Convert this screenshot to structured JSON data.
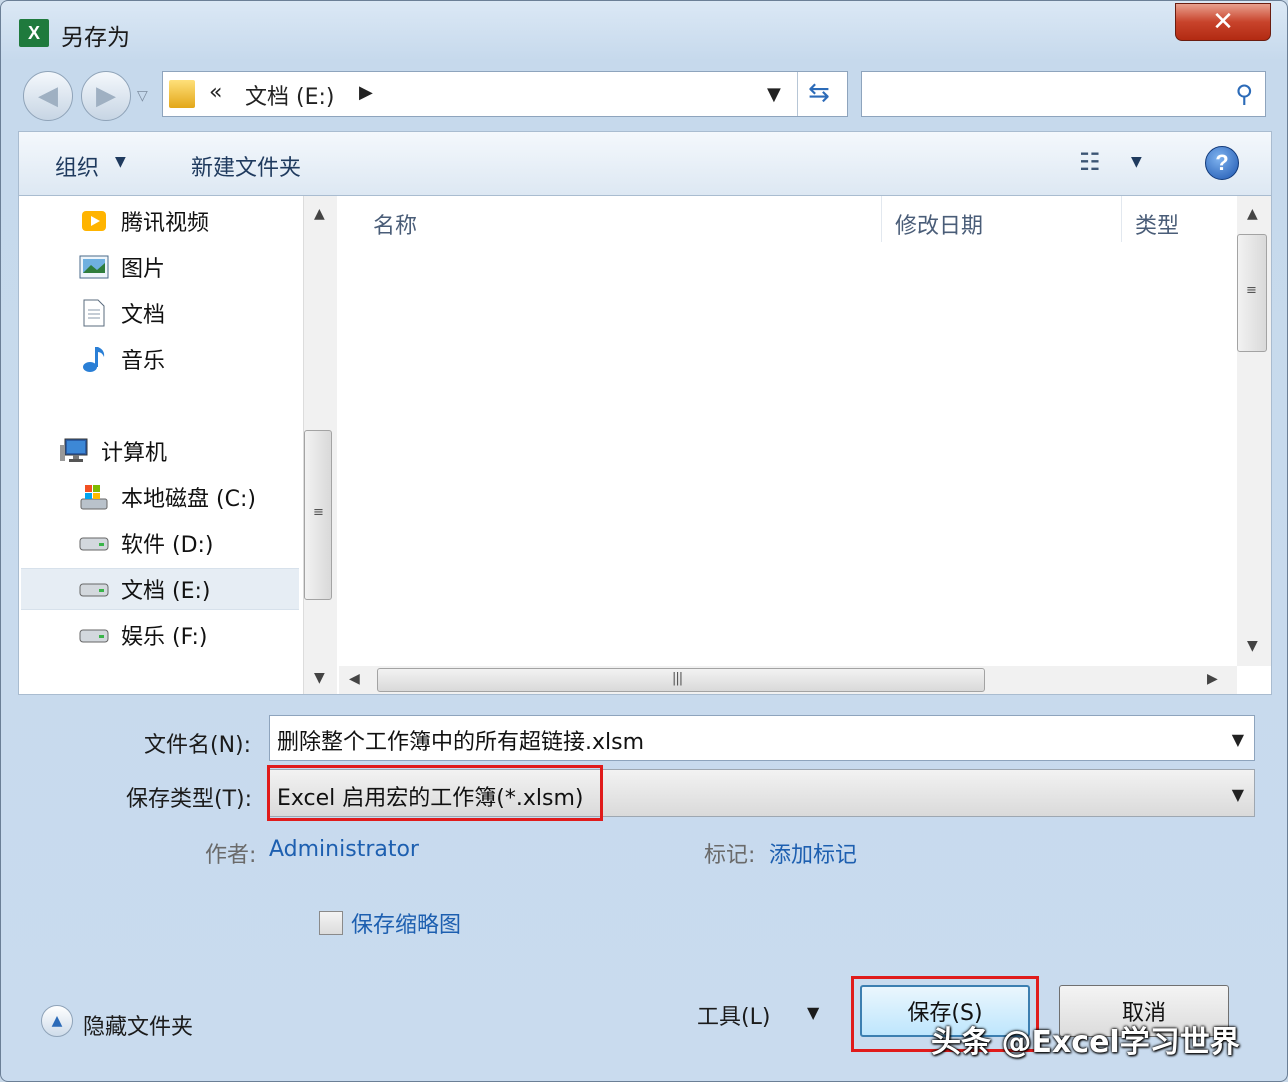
{
  "window": {
    "title": "另存为",
    "app_icon": "X",
    "close_label": "✕"
  },
  "nav": {
    "breadcrumb_chevron": "«",
    "address": "文档 (E:)",
    "address_arrow": "▶",
    "search_placeholder": ""
  },
  "toolbar": {
    "organize": "组织",
    "new_folder": "新建文件夹",
    "help": "?"
  },
  "sidebar": {
    "items": [
      {
        "label": "腾讯视频"
      },
      {
        "label": "图片"
      },
      {
        "label": "文档"
      },
      {
        "label": "音乐"
      },
      {
        "label": "计算机"
      },
      {
        "label": "本地磁盘 (C:)"
      },
      {
        "label": "软件 (D:)"
      },
      {
        "label": "文档 (E:)"
      },
      {
        "label": "娱乐 (F:)"
      }
    ]
  },
  "columns": {
    "name": "名称",
    "modified": "修改日期",
    "type": "类型"
  },
  "form": {
    "filename_label": "文件名(N):",
    "filename_value": "删除整个工作簿中的所有超链接.xlsm",
    "filetype_label": "保存类型(T):",
    "filetype_value": "Excel 启用宏的工作簿(*.xlsm)",
    "author_label": "作者:",
    "author_value": "Administrator",
    "tags_label": "标记:",
    "tags_value": "添加标记",
    "thumbnail_label": "保存缩略图"
  },
  "footer": {
    "hide_folders": "隐藏文件夹",
    "tools": "工具(L)",
    "save": "保存(S)",
    "cancel": "取消"
  },
  "watermark": "头条 @Excel学习世界",
  "colors": {
    "highlight": "#e01b1b",
    "link": "#1d5fb0",
    "accent": "#2c6bb8"
  }
}
